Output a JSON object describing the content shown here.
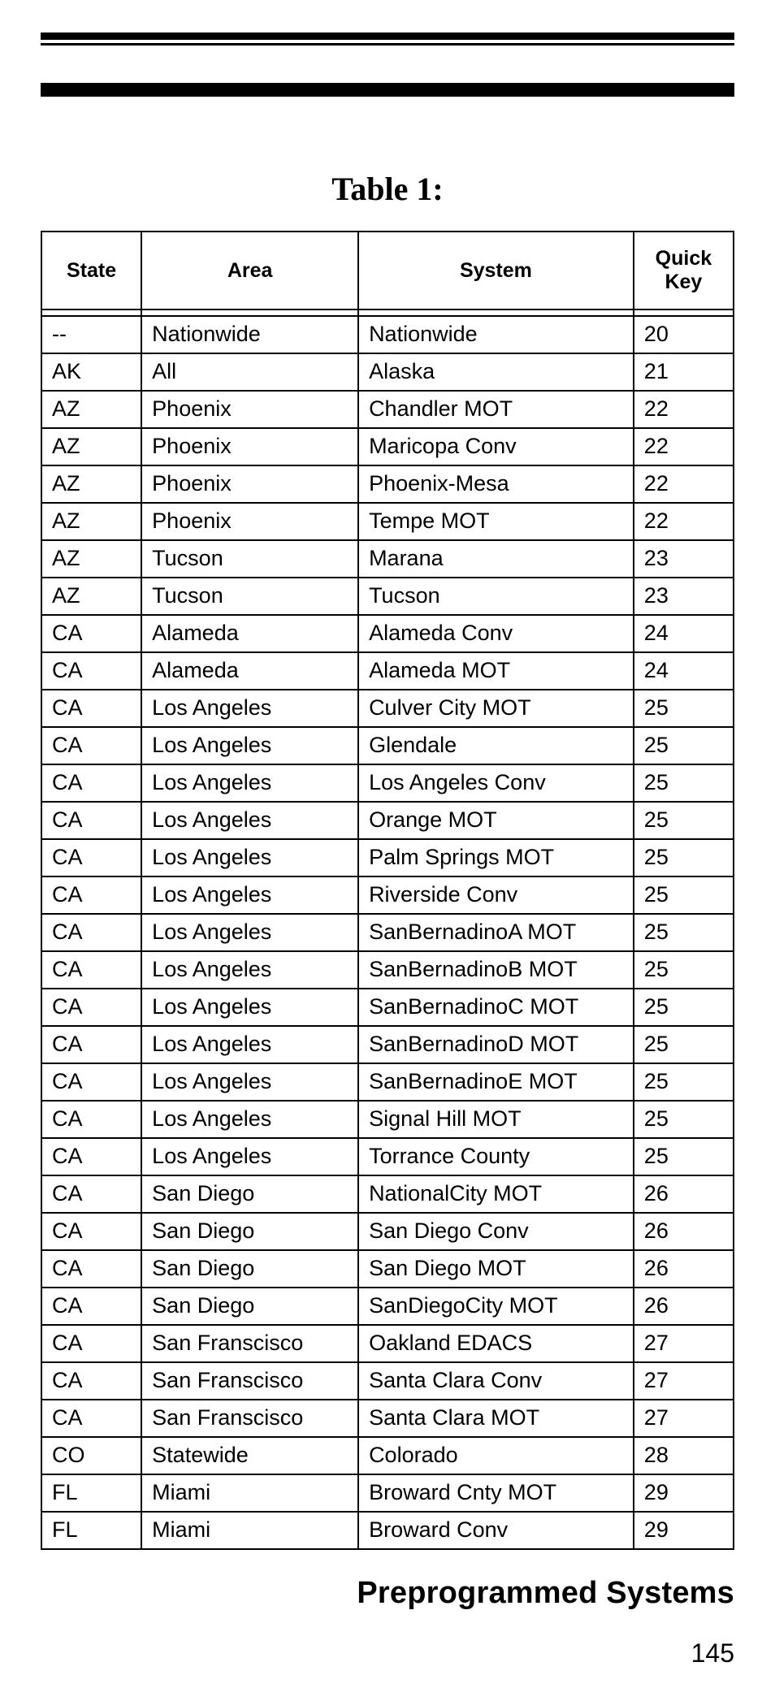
{
  "chart_data": {
    "type": "table",
    "title": "Table 1:",
    "columns": [
      "State",
      "Area",
      "System",
      "Quick Key"
    ],
    "rows": [
      [
        "--",
        "Nationwide",
        "Nationwide",
        20
      ],
      [
        "AK",
        "All",
        "Alaska",
        21
      ],
      [
        "AZ",
        "Phoenix",
        "Chandler MOT",
        22
      ],
      [
        "AZ",
        "Phoenix",
        "Maricopa Conv",
        22
      ],
      [
        "AZ",
        "Phoenix",
        "Phoenix-Mesa",
        22
      ],
      [
        "AZ",
        "Phoenix",
        "Tempe MOT",
        22
      ],
      [
        "AZ",
        "Tucson",
        "Marana",
        23
      ],
      [
        "AZ",
        "Tucson",
        "Tucson",
        23
      ],
      [
        "CA",
        "Alameda",
        "Alameda Conv",
        24
      ],
      [
        "CA",
        "Alameda",
        "Alameda MOT",
        24
      ],
      [
        "CA",
        "Los Angeles",
        "Culver City MOT",
        25
      ],
      [
        "CA",
        "Los Angeles",
        "Glendale",
        25
      ],
      [
        "CA",
        "Los Angeles",
        "Los Angeles Conv",
        25
      ],
      [
        "CA",
        "Los Angeles",
        "Orange MOT",
        25
      ],
      [
        "CA",
        "Los Angeles",
        "Palm Springs MOT",
        25
      ],
      [
        "CA",
        "Los Angeles",
        "Riverside Conv",
        25
      ],
      [
        "CA",
        "Los Angeles",
        "SanBernadinoA MOT",
        25
      ],
      [
        "CA",
        "Los Angeles",
        "SanBernadinoB MOT",
        25
      ],
      [
        "CA",
        "Los Angeles",
        "SanBernadinoC MOT",
        25
      ],
      [
        "CA",
        "Los Angeles",
        "SanBernadinoD MOT",
        25
      ],
      [
        "CA",
        "Los Angeles",
        "SanBernadinoE MOT",
        25
      ],
      [
        "CA",
        "Los Angeles",
        "Signal Hill MOT",
        25
      ],
      [
        "CA",
        "Los Angeles",
        "Torrance County",
        25
      ],
      [
        "CA",
        "San Diego",
        "NationalCity MOT",
        26
      ],
      [
        "CA",
        "San Diego",
        "San Diego Conv",
        26
      ],
      [
        "CA",
        "San Diego",
        "San Diego MOT",
        26
      ],
      [
        "CA",
        "San Diego",
        "SanDiegoCity MOT",
        26
      ],
      [
        "CA",
        "San Franscisco",
        "Oakland EDACS",
        27
      ],
      [
        "CA",
        "San Franscisco",
        "Santa Clara Conv",
        27
      ],
      [
        "CA",
        "San Franscisco",
        "Santa Clara MOT",
        27
      ],
      [
        "CO",
        "Statewide",
        "Colorado",
        28
      ],
      [
        "FL",
        "Miami",
        "Broward Cnty MOT",
        29
      ],
      [
        "FL",
        "Miami",
        "Broward Conv",
        29
      ]
    ]
  },
  "section_title": "Preprogrammed Systems",
  "page_number": "145"
}
